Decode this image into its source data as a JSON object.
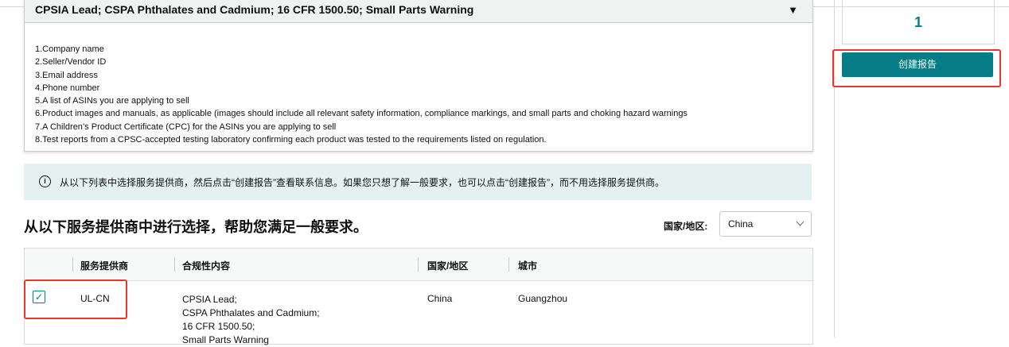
{
  "requirement_section": {
    "title": "CPSIA Lead; CSPA Phthalates and Cadmium; 16 CFR 1500.50; Small Parts Warning",
    "collapse_icon": "caret-down-icon",
    "items": [
      "1.Company name",
      "2.Seller/Vendor ID",
      "3.Email address",
      "4.Phone number",
      "5.A list of ASINs you are applying to sell",
      "6.Product images and manuals, as applicable (images should include all relevant safety information, compliance markings, and small parts and choking hazard warnings",
      "7.A Children’s Product Certificate (CPC) for the ASINs you are applying to sell",
      "8.Test reports from a CPSC-accepted testing laboratory confirming each product was tested to the requirements listed on regulation."
    ]
  },
  "info_alert": {
    "icon": "info-icon",
    "text": "从以下列表中选择服务提供商，然后点击“创建报告”查看联系信息。如果您只想了解一般要求，也可以点击“创建报告”，而不用选择服务提供商。"
  },
  "provider_section": {
    "title": "从以下服务提供商中进行选择，帮助您满足一般要求。",
    "country_label": "国家/地区:",
    "country_selected": "China"
  },
  "table": {
    "headers": [
      "服务提供商",
      "合规性内容",
      "国家/地区",
      "城市"
    ],
    "rows": [
      {
        "checked": true,
        "provider": "UL-CN",
        "compliance": [
          "CPSIA Lead;",
          "CSPA Phthalates and Cadmium;",
          "16 CFR 1500.50;",
          "Small Parts Warning"
        ],
        "country": "China",
        "city": "Guangzhou"
      }
    ]
  },
  "sidebar": {
    "selected_count": "1",
    "create_report_label": "创建报告"
  },
  "colors": {
    "accent": "#067d86",
    "highlight": "#e8372a",
    "info_bg": "#e5f1f1"
  }
}
